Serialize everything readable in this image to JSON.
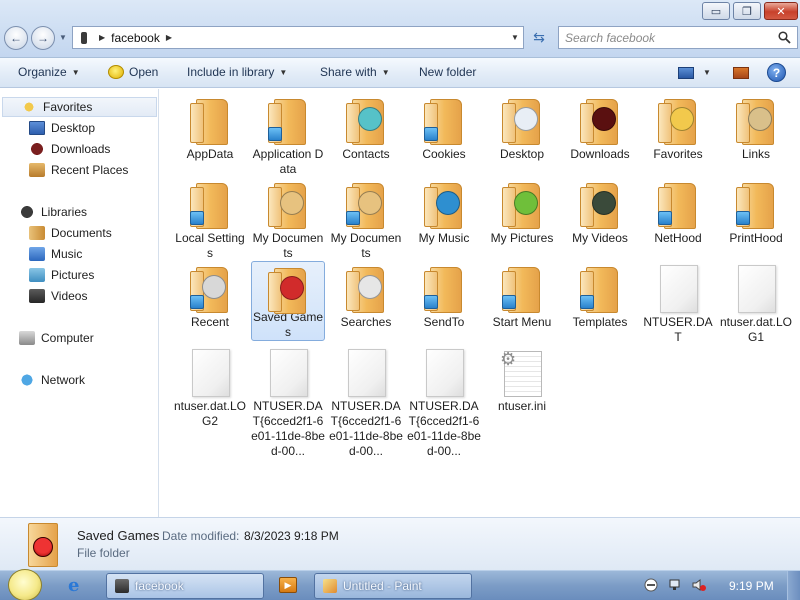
{
  "window": {
    "minimize": "▭",
    "maximize": "❐",
    "close": "✕"
  },
  "nav": {
    "back_glyph": "←",
    "forward_glyph": "→"
  },
  "address": {
    "path": "facebook"
  },
  "search": {
    "placeholder": "Search facebook"
  },
  "toolbar": {
    "organize": "Organize",
    "open": "Open",
    "include": "Include in library",
    "share": "Share with",
    "new_folder": "New folder",
    "help": "?"
  },
  "sidebar": {
    "favorites": "Favorites",
    "desktop": "Desktop",
    "downloads": "Downloads",
    "recent": "Recent Places",
    "libraries": "Libraries",
    "documents": "Documents",
    "music": "Music",
    "pictures": "Pictures",
    "videos": "Videos",
    "computer": "Computer",
    "network": "Network"
  },
  "items": [
    {
      "name": "AppData",
      "kind": "folder"
    },
    {
      "name": "Application Data",
      "kind": "folder-shortcut"
    },
    {
      "name": "Contacts",
      "kind": "folder"
    },
    {
      "name": "Cookies",
      "kind": "folder-shortcut"
    },
    {
      "name": "Desktop",
      "kind": "folder"
    },
    {
      "name": "Downloads",
      "kind": "folder"
    },
    {
      "name": "Favorites",
      "kind": "folder"
    },
    {
      "name": "Links",
      "kind": "folder"
    },
    {
      "name": "Local Settings",
      "kind": "folder-shortcut"
    },
    {
      "name": "My Documents",
      "kind": "folder"
    },
    {
      "name": "My Documents",
      "kind": "folder-shortcut"
    },
    {
      "name": "My Music",
      "kind": "folder"
    },
    {
      "name": "My Pictures",
      "kind": "folder"
    },
    {
      "name": "My Videos",
      "kind": "folder"
    },
    {
      "name": "NetHood",
      "kind": "folder-shortcut"
    },
    {
      "name": "PrintHood",
      "kind": "folder-shortcut"
    },
    {
      "name": "Recent",
      "kind": "folder-shortcut"
    },
    {
      "name": "Saved Games",
      "kind": "folder"
    },
    {
      "name": "Searches",
      "kind": "folder"
    },
    {
      "name": "SendTo",
      "kind": "folder-shortcut"
    },
    {
      "name": "Start Menu",
      "kind": "folder-shortcut"
    },
    {
      "name": "Templates",
      "kind": "folder-shortcut"
    },
    {
      "name": "NTUSER.DAT",
      "kind": "file"
    },
    {
      "name": "ntuser.dat.LOG1",
      "kind": "file"
    },
    {
      "name": "ntuser.dat.LOG2",
      "kind": "file"
    },
    {
      "name": "NTUSER.DAT{6cced2f1-6e01-11de-8bed-00...",
      "kind": "file"
    },
    {
      "name": "NTUSER.DAT{6cced2f1-6e01-11de-8bed-00...",
      "kind": "file"
    },
    {
      "name": "NTUSER.DAT{6cced2f1-6e01-11de-8bed-00...",
      "kind": "file"
    },
    {
      "name": "ntuser.ini",
      "kind": "inifile"
    }
  ],
  "selected_item": "Saved Games",
  "details": {
    "name": "Saved Games",
    "modified_label": "Date modified:",
    "modified_value": "8/3/2023 9:18 PM",
    "type": "File folder"
  },
  "taskbar": {
    "task1": "facebook",
    "task2": "Untitled - Paint",
    "clock": "9:19 PM"
  },
  "colors": {
    "accent": "#3b6fb0",
    "selection_bg": "#cfe2fa",
    "selection_border": "#84acdd",
    "folder": "#f2b95a"
  }
}
